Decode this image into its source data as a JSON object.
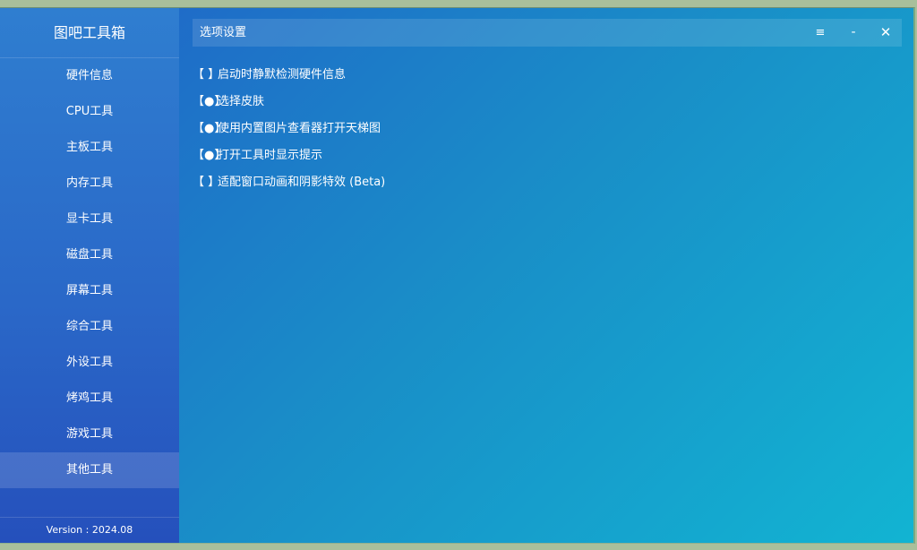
{
  "app": {
    "title": "图吧工具箱",
    "version": "Version : 2024.08"
  },
  "sidebar": {
    "items": [
      {
        "label": "硬件信息",
        "active": false
      },
      {
        "label": "CPU工具",
        "active": false
      },
      {
        "label": "主板工具",
        "active": false
      },
      {
        "label": "内存工具",
        "active": false
      },
      {
        "label": "显卡工具",
        "active": false
      },
      {
        "label": "磁盘工具",
        "active": false
      },
      {
        "label": "屏幕工具",
        "active": false
      },
      {
        "label": "综合工具",
        "active": false
      },
      {
        "label": "外设工具",
        "active": false
      },
      {
        "label": "烤鸡工具",
        "active": false
      },
      {
        "label": "游戏工具",
        "active": false
      },
      {
        "label": "其他工具",
        "active": true
      }
    ]
  },
  "panel": {
    "title": "选项设置",
    "menu_icon": "≡",
    "minimize_icon": "-",
    "close_icon": "✕"
  },
  "options": [
    {
      "mark": "【 】",
      "label": "启动时静默检测硬件信息",
      "checked": false
    },
    {
      "mark": "【●】",
      "label": "选择皮肤",
      "checked": true
    },
    {
      "mark": "【●】",
      "label": "使用内置图片查看器打开天梯图",
      "checked": true
    },
    {
      "mark": "【●】",
      "label": "打开工具时显示提示",
      "checked": true
    },
    {
      "mark": "【 】",
      "label": "适配窗口动画和阴影特效 (Beta)",
      "checked": false
    }
  ]
}
